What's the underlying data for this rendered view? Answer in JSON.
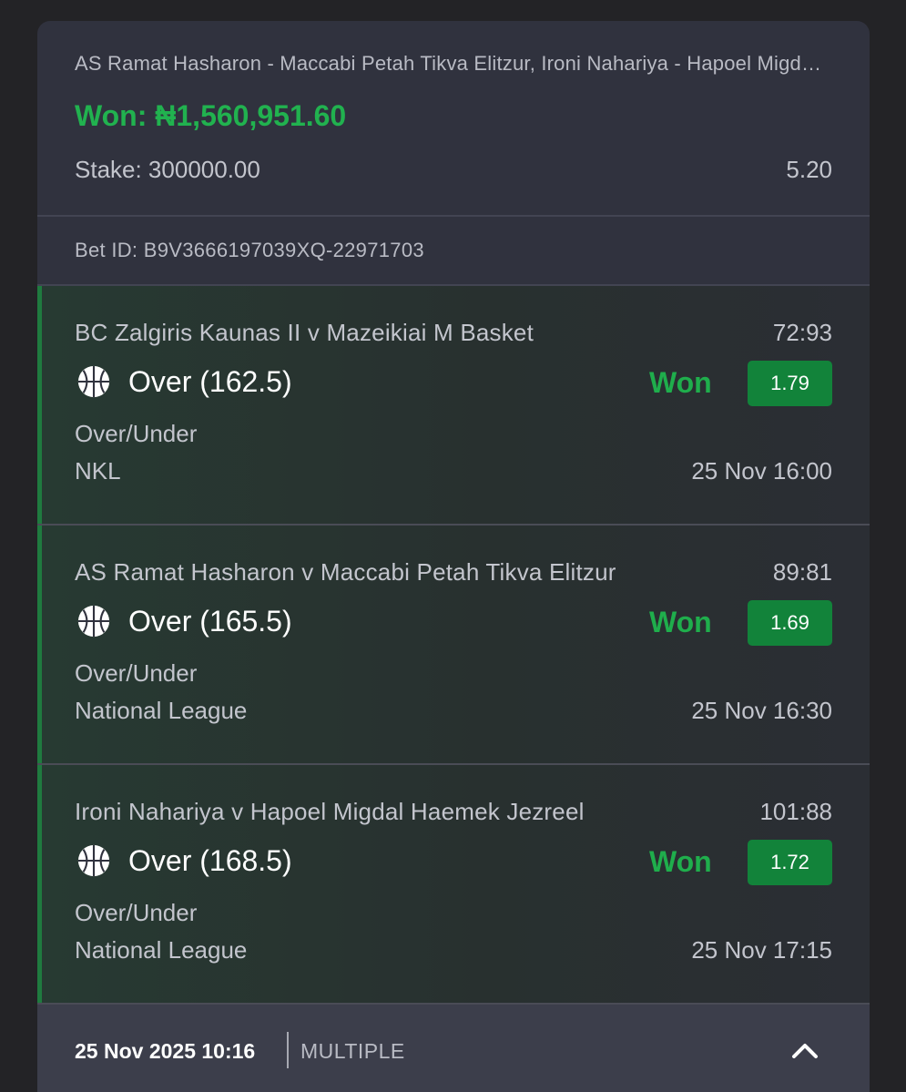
{
  "ticket": {
    "title": "AS Ramat Hasharon - Maccabi Petah Tikva Elitzur, Ironi Nahariya - Hapoel Migdal Haemek Jezreel",
    "won_text": "Won: ₦1,560,951.60",
    "stake_text": "Stake: 300000.00",
    "total_odds": "5.20",
    "bet_id_text": "Bet ID: B9V3666197039XQ-22971703"
  },
  "selections": [
    {
      "match": "BC Zalgiris Kaunas II v Mazeikiai M Basket",
      "score": "72:93",
      "pick": "Over (162.5)",
      "status": "Won",
      "odds": "1.79",
      "market": "Over/Under",
      "league": "NKL",
      "kickoff": "25 Nov 16:00",
      "icon": "basketball-icon"
    },
    {
      "match": "AS Ramat Hasharon v Maccabi Petah Tikva Elitzur",
      "score": "89:81",
      "pick": "Over (165.5)",
      "status": "Won",
      "odds": "1.69",
      "market": "Over/Under",
      "league": "National League",
      "kickoff": "25 Nov 16:30",
      "icon": "basketball-icon"
    },
    {
      "match": "Ironi Nahariya v Hapoel Migdal Haemek Jezreel",
      "score": "101:88",
      "pick": "Over (168.5)",
      "status": "Won",
      "odds": "1.72",
      "market": "Over/Under",
      "league": "National League",
      "kickoff": "25 Nov 17:15",
      "icon": "basketball-icon"
    }
  ],
  "footer": {
    "placed_at": "25 Nov 2025 10:16",
    "bet_type": "MULTIPLE",
    "collapse_icon": "chevron-up-icon"
  },
  "colors": {
    "background": "#232326",
    "card": "#30323e",
    "won_green": "#21b24f",
    "odds_badge": "#12833a",
    "footer": "#3c3e4b"
  }
}
